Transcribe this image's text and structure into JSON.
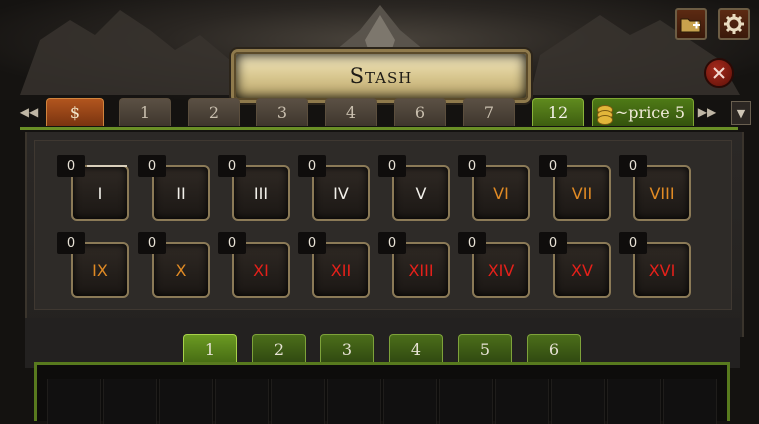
{
  "header": {
    "title": "Stash"
  },
  "icons": {
    "new_tab": "folder-plus-icon",
    "settings": "gear-icon",
    "close": "close-icon",
    "prev": "double-chevron-left-icon",
    "next": "double-chevron-right-icon",
    "dropdown": "chevron-down-icon"
  },
  "colors": {
    "active_tab": "#5f8a1e",
    "money_tab": "#b1551e",
    "numeral_white": "#f2f0ea",
    "numeral_orange": "#e08a24",
    "numeral_red": "#e5201a",
    "close_red": "#a52a1c"
  },
  "tabs": [
    {
      "label": "$",
      "kind": "money"
    },
    {
      "label": "1"
    },
    {
      "label": "2"
    },
    {
      "label": "3"
    },
    {
      "label": "4"
    },
    {
      "label": "6"
    },
    {
      "label": "7"
    },
    {
      "label": "12",
      "active": true
    },
    {
      "label": "~price 5",
      "kind": "price"
    }
  ],
  "slots": [
    {
      "count": "0",
      "numeral": "I"
    },
    {
      "count": "0",
      "numeral": "II"
    },
    {
      "count": "0",
      "numeral": "III"
    },
    {
      "count": "0",
      "numeral": "IV"
    },
    {
      "count": "0",
      "numeral": "V"
    },
    {
      "count": "0",
      "numeral": "VI"
    },
    {
      "count": "0",
      "numeral": "VII"
    },
    {
      "count": "0",
      "numeral": "VIII"
    },
    {
      "count": "0",
      "numeral": "IX"
    },
    {
      "count": "0",
      "numeral": "X"
    },
    {
      "count": "0",
      "numeral": "XI"
    },
    {
      "count": "0",
      "numeral": "XII"
    },
    {
      "count": "0",
      "numeral": "XIII"
    },
    {
      "count": "0",
      "numeral": "XIV"
    },
    {
      "count": "0",
      "numeral": "XV"
    },
    {
      "count": "0",
      "numeral": "XVI"
    }
  ],
  "subtabs": [
    {
      "label": "1",
      "active": true
    },
    {
      "label": "2"
    },
    {
      "label": "3"
    },
    {
      "label": "4"
    },
    {
      "label": "5"
    },
    {
      "label": "6"
    }
  ]
}
